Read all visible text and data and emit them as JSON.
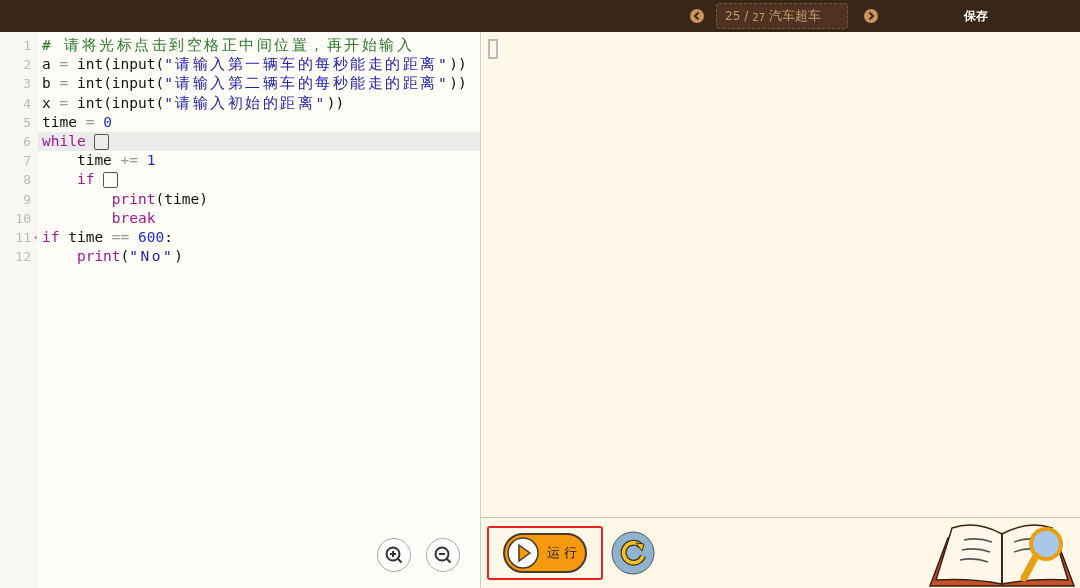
{
  "topbar": {
    "current": "25",
    "separator": "/",
    "total": "27",
    "title": "汽车超车",
    "save": "保存"
  },
  "editor": {
    "lines": [
      {
        "number": "1",
        "highlighted": false,
        "tokens": [
          {
            "kind": "comment",
            "text": "# 请将光标点击到空格正中间位置，再开始输入"
          }
        ]
      },
      {
        "number": "2",
        "highlighted": false,
        "tokens": [
          {
            "kind": "name",
            "text": "a "
          },
          {
            "kind": "op",
            "text": "="
          },
          {
            "kind": "name",
            "text": " int(input("
          },
          {
            "kind": "string",
            "text": "\"请输入第一辆车的每秒能走的距离\""
          },
          {
            "kind": "name",
            "text": "))"
          }
        ]
      },
      {
        "number": "3",
        "highlighted": false,
        "tokens": [
          {
            "kind": "name",
            "text": "b "
          },
          {
            "kind": "op",
            "text": "="
          },
          {
            "kind": "name",
            "text": " int(input("
          },
          {
            "kind": "string",
            "text": "\"请输入第二辆车的每秒能走的距离\""
          },
          {
            "kind": "name",
            "text": "))"
          }
        ]
      },
      {
        "number": "4",
        "highlighted": false,
        "tokens": [
          {
            "kind": "name",
            "text": "x "
          },
          {
            "kind": "op",
            "text": "="
          },
          {
            "kind": "name",
            "text": " int(input("
          },
          {
            "kind": "string",
            "text": "\"请输入初始的距离\""
          },
          {
            "kind": "name",
            "text": "))"
          }
        ]
      },
      {
        "number": "5",
        "highlighted": false,
        "tokens": [
          {
            "kind": "name",
            "text": "time "
          },
          {
            "kind": "op",
            "text": "="
          },
          {
            "kind": "number",
            "text": " 0"
          }
        ]
      },
      {
        "number": "6",
        "highlighted": true,
        "tokens": [
          {
            "kind": "keyword",
            "text": "while "
          },
          {
            "kind": "blank"
          }
        ]
      },
      {
        "number": "7",
        "highlighted": false,
        "tokens": [
          {
            "kind": "name",
            "text": "    time "
          },
          {
            "kind": "op",
            "text": "+="
          },
          {
            "kind": "number",
            "text": " 1"
          }
        ]
      },
      {
        "number": "8",
        "highlighted": false,
        "tokens": [
          {
            "kind": "keyword",
            "text": "    if "
          },
          {
            "kind": "blank"
          }
        ]
      },
      {
        "number": "9",
        "highlighted": false,
        "tokens": [
          {
            "kind": "keyword",
            "text": "        print"
          },
          {
            "kind": "name",
            "text": "(time)"
          }
        ]
      },
      {
        "number": "10",
        "highlighted": false,
        "tokens": [
          {
            "kind": "keyword",
            "text": "        break"
          }
        ]
      },
      {
        "number": "11",
        "highlighted": false,
        "fold_marker": "▾",
        "tokens": [
          {
            "kind": "keyword",
            "text": "if"
          },
          {
            "kind": "name",
            "text": " time "
          },
          {
            "kind": "op",
            "text": "=="
          },
          {
            "kind": "number",
            "text": " 600"
          },
          {
            "kind": "name",
            "text": ":"
          }
        ]
      },
      {
        "number": "12",
        "highlighted": false,
        "tokens": [
          {
            "kind": "keyword",
            "text": "    print"
          },
          {
            "kind": "name",
            "text": "("
          },
          {
            "kind": "string",
            "text": "\"No\""
          },
          {
            "kind": "name",
            "text": ")"
          }
        ]
      }
    ]
  },
  "run_button": {
    "label": "运 行",
    "highlighted": true
  }
}
